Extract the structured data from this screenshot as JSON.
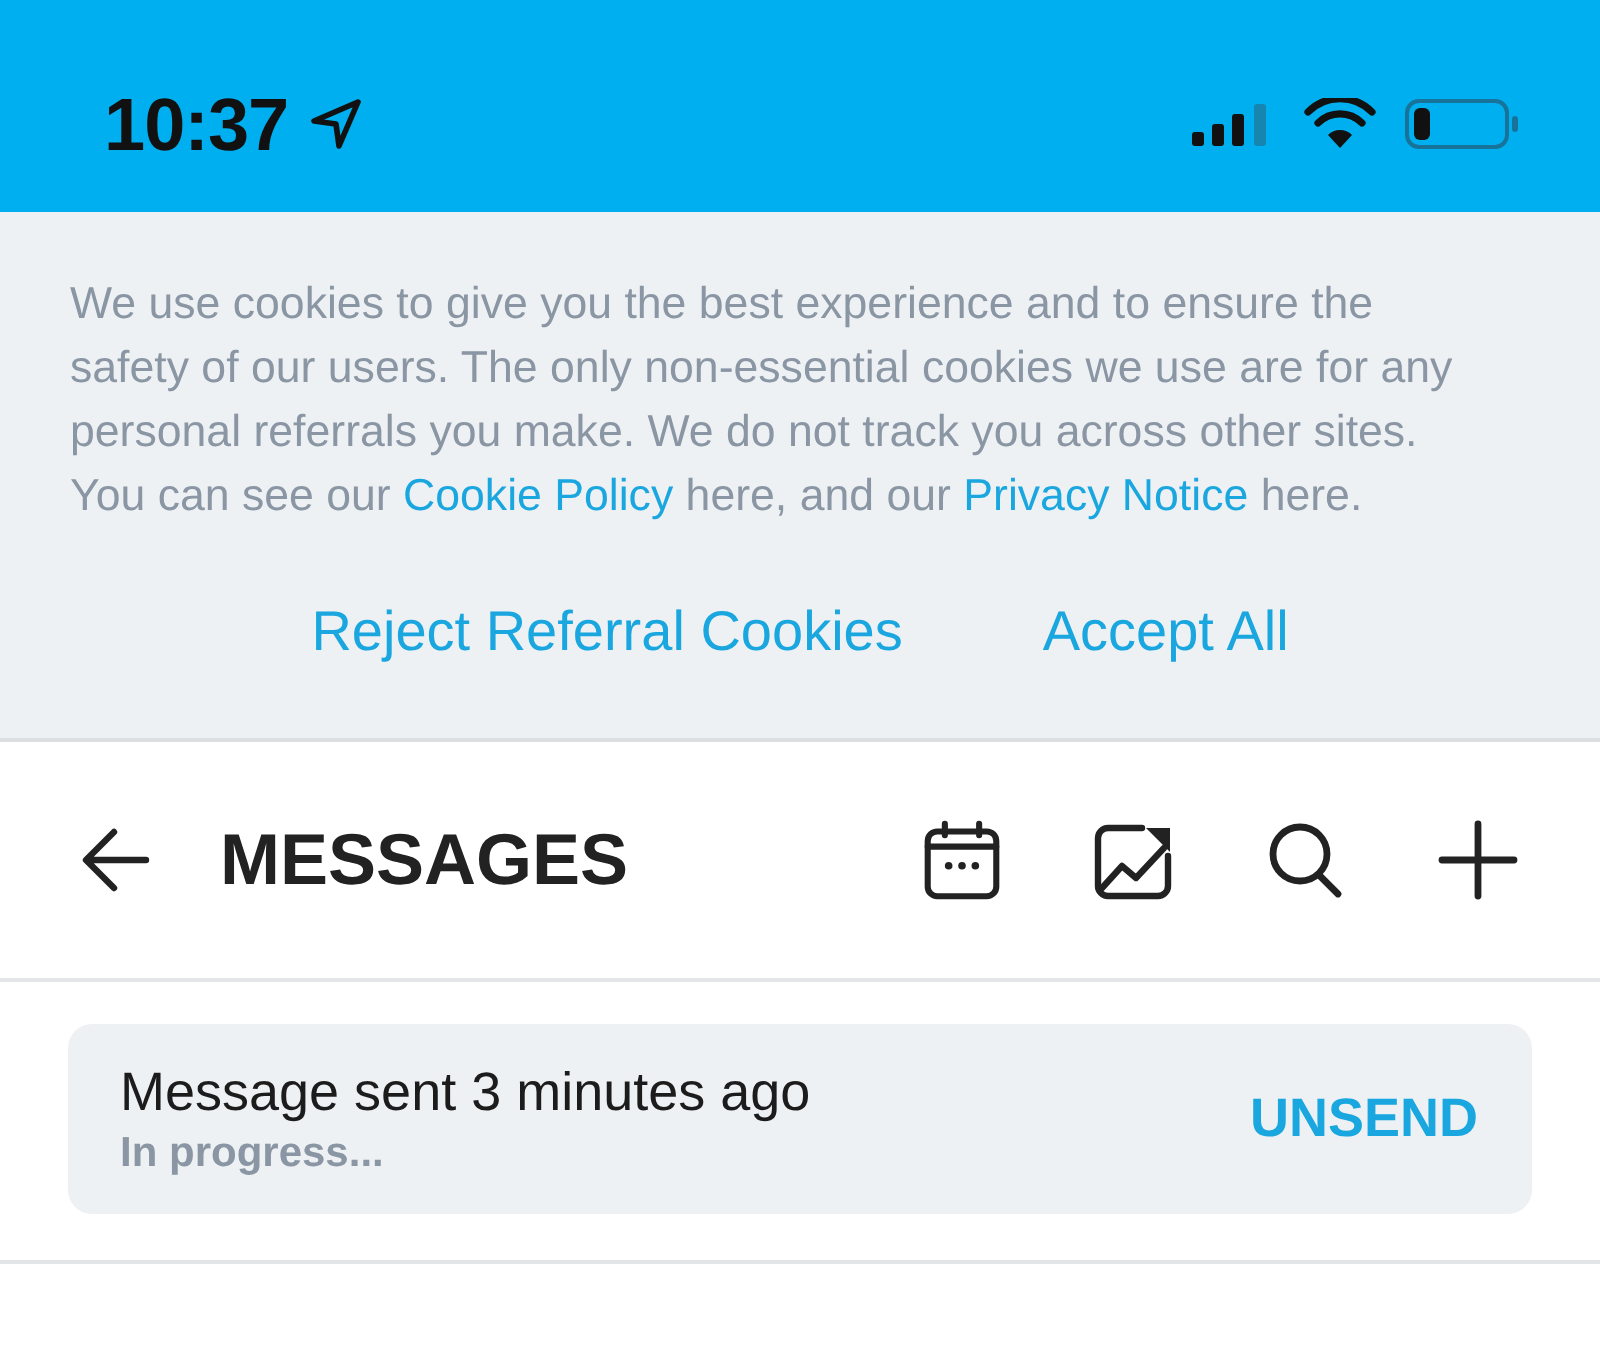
{
  "status_bar": {
    "time": "10:37"
  },
  "cookie_banner": {
    "notice": {
      "before": "We use cookies to give you the best experience and to ensure the safety of our users. The only non-essential cookies we use are for any personal referrals you make. We do not track you across other sites. You can see our ",
      "cookie_policy_link": "Cookie Policy",
      "middle": " here, and our ",
      "privacy_notice_link": "Privacy Notice",
      "after": " here."
    },
    "reject_button": "Reject Referral Cookies",
    "accept_button": "Accept All"
  },
  "header": {
    "title": "MESSAGES"
  },
  "sent_message": {
    "title": "Message sent 3 minutes ago",
    "status": "In progress...",
    "action": "UNSEND"
  }
}
